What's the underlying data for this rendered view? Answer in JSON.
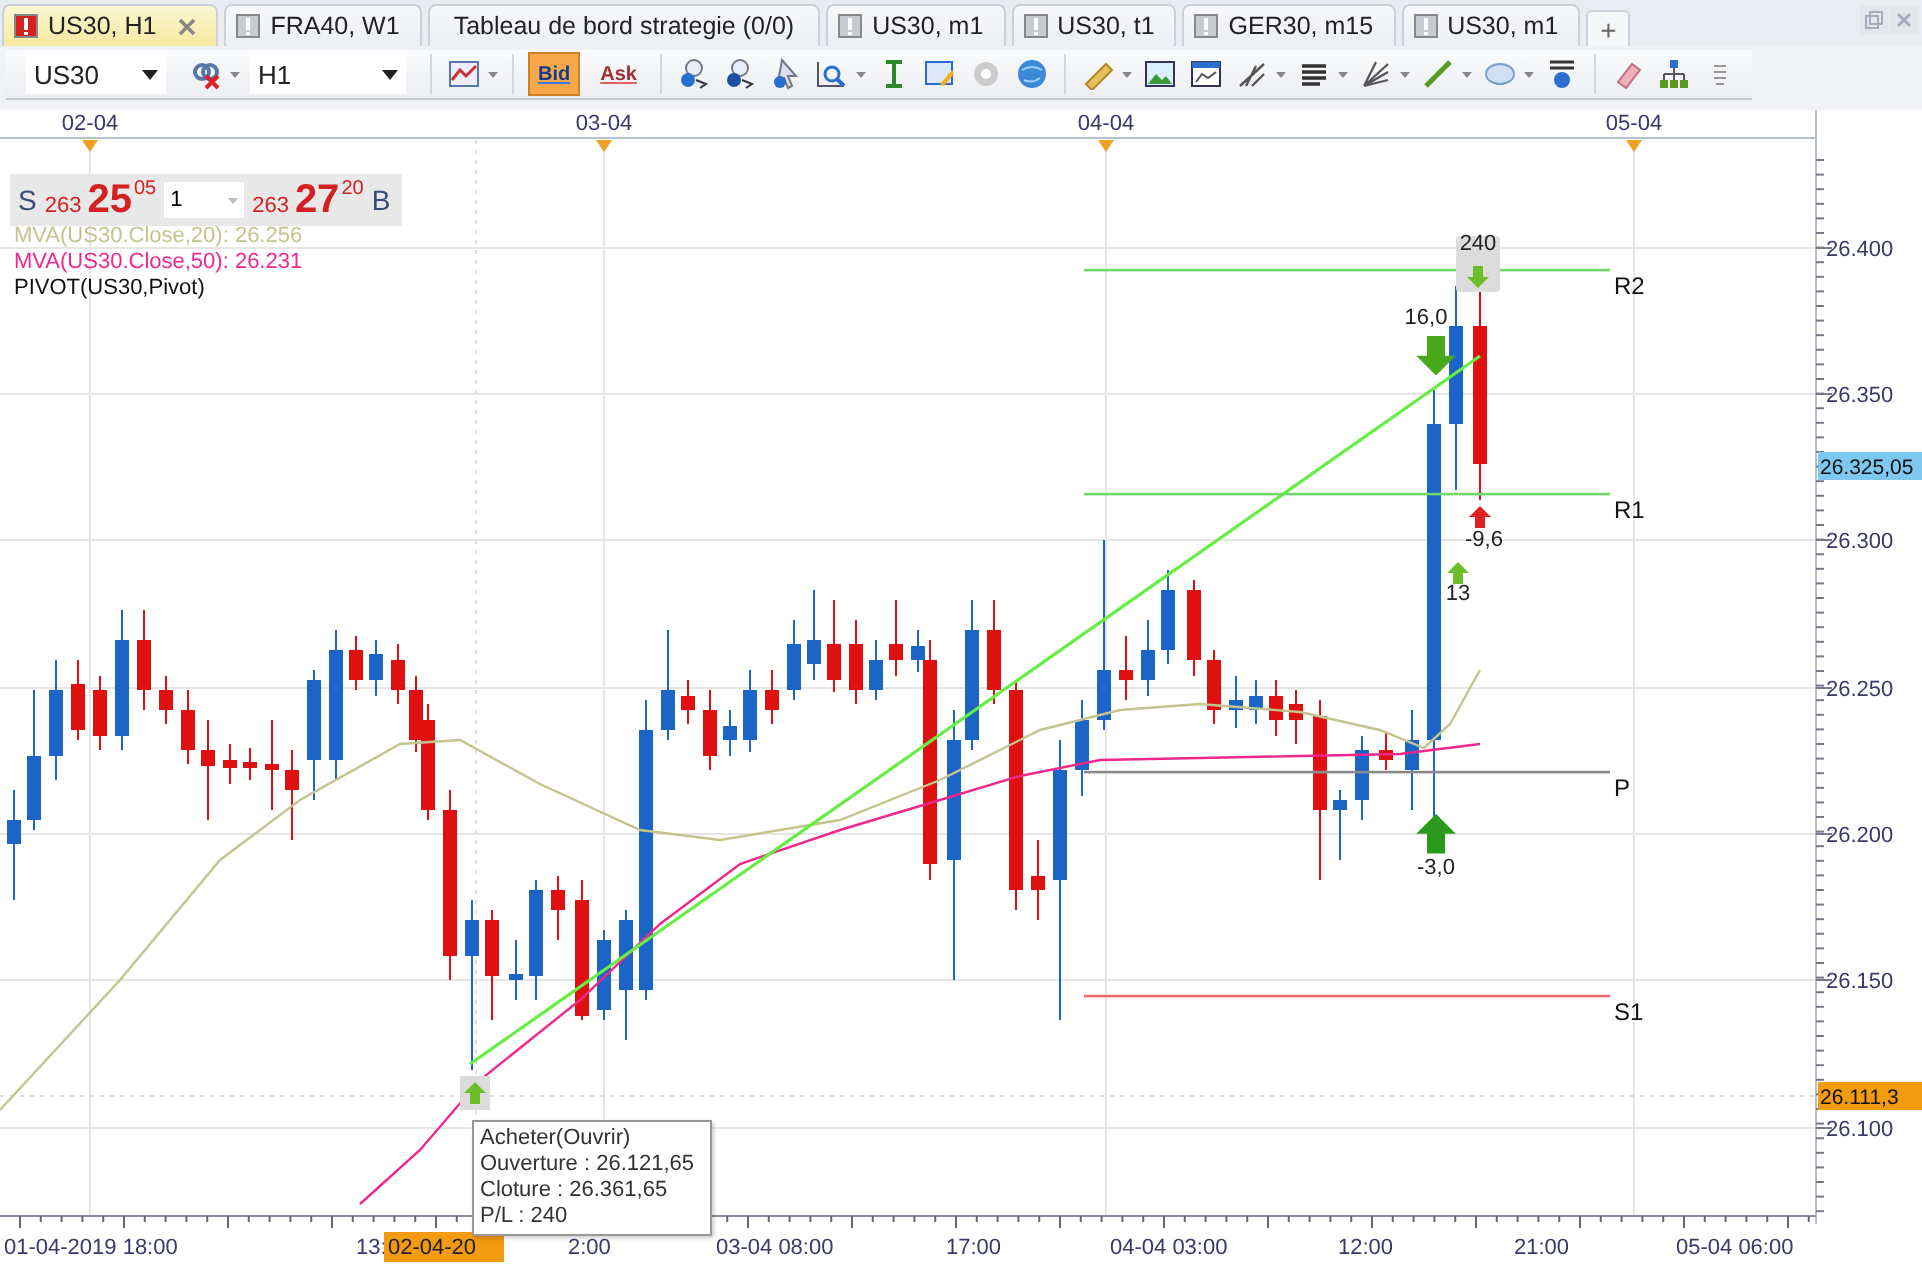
{
  "tabs": [
    {
      "label": "US30, H1",
      "selected": true,
      "closable": true
    },
    {
      "label": "FRA40, W1",
      "selected": false,
      "closable": false
    },
    {
      "label": "Tableau de bord strategie (0/0)",
      "selected": false,
      "closable": false
    },
    {
      "label": "US30, m1",
      "selected": false,
      "closable": false
    },
    {
      "label": "US30, t1",
      "selected": false,
      "closable": false
    },
    {
      "label": "GER30, m15",
      "selected": false,
      "closable": false
    },
    {
      "label": "US30, m1",
      "selected": false,
      "closable": false
    }
  ],
  "add_tab": "+",
  "toolbar": {
    "symbol": "US30",
    "timeframe": "H1",
    "price_buttons": [
      {
        "label": "Bid",
        "selected": true
      },
      {
        "label": "Ask",
        "selected": false
      }
    ]
  },
  "quote": {
    "sell_label": "S",
    "sell_prefix": "263",
    "sell_main": "25",
    "sell_sup": "05",
    "quantity": "1",
    "buy_prefix": "263",
    "buy_main": "27",
    "buy_sup": "20",
    "buy_label": "B"
  },
  "indicators": [
    {
      "text": "MVA(US30.Close,20): 26.256",
      "color": "#c4c48e"
    },
    {
      "text": "MVA(US30.Close,50): 26.231",
      "color": "#f0288c"
    },
    {
      "text": "PIVOT(US30,Pivot)",
      "color": "#111111"
    }
  ],
  "chart": {
    "date_labels": [
      "02-04",
      "03-04",
      "04-04",
      "05-04"
    ],
    "price_labels": [
      "26.400",
      "26.350",
      "26.300",
      "26.250",
      "26.200",
      "26.150",
      "26.100"
    ],
    "price_tags": [
      {
        "text": "26.325,05",
        "kind": "last"
      },
      {
        "text": "26.111,3",
        "kind": "cursor"
      }
    ],
    "pivots": [
      {
        "label": "R2",
        "color": "#6fd86a"
      },
      {
        "label": "R1",
        "color": "#6fd86a"
      },
      {
        "label": "P",
        "color": "#8a8a8a"
      },
      {
        "label": "S1",
        "color": "#ee6a6a"
      }
    ],
    "markers": [
      {
        "label": "240",
        "kind": "down-small",
        "color": "#6cbf2a",
        "boxed": true
      },
      {
        "label": "16,0",
        "kind": "down-large",
        "color": "#4aa81c",
        "boxed": false
      },
      {
        "label": "-9,6",
        "kind": "up-small",
        "color": "#e02020",
        "boxed": false
      },
      {
        "label": "13",
        "kind": "up-small",
        "color": "#6cbf2a",
        "boxed": false
      },
      {
        "label": "-3,0",
        "kind": "up-large",
        "color": "#2a9a1a",
        "boxed": false
      }
    ],
    "time_labels": [
      "01-04-2019 18:00",
      "13:",
      "2:00",
      "03-04 08:00",
      "17:00",
      "04-04 03:00",
      "12:00",
      "21:00",
      "05-04 06:00"
    ],
    "cursor_time": "02-04-20"
  },
  "tooltip": {
    "lines": [
      "Acheter(Ouvrir)",
      "Ouverture : 26.121,65",
      "Cloture : 26.361,65",
      "P/L : 240"
    ]
  }
}
